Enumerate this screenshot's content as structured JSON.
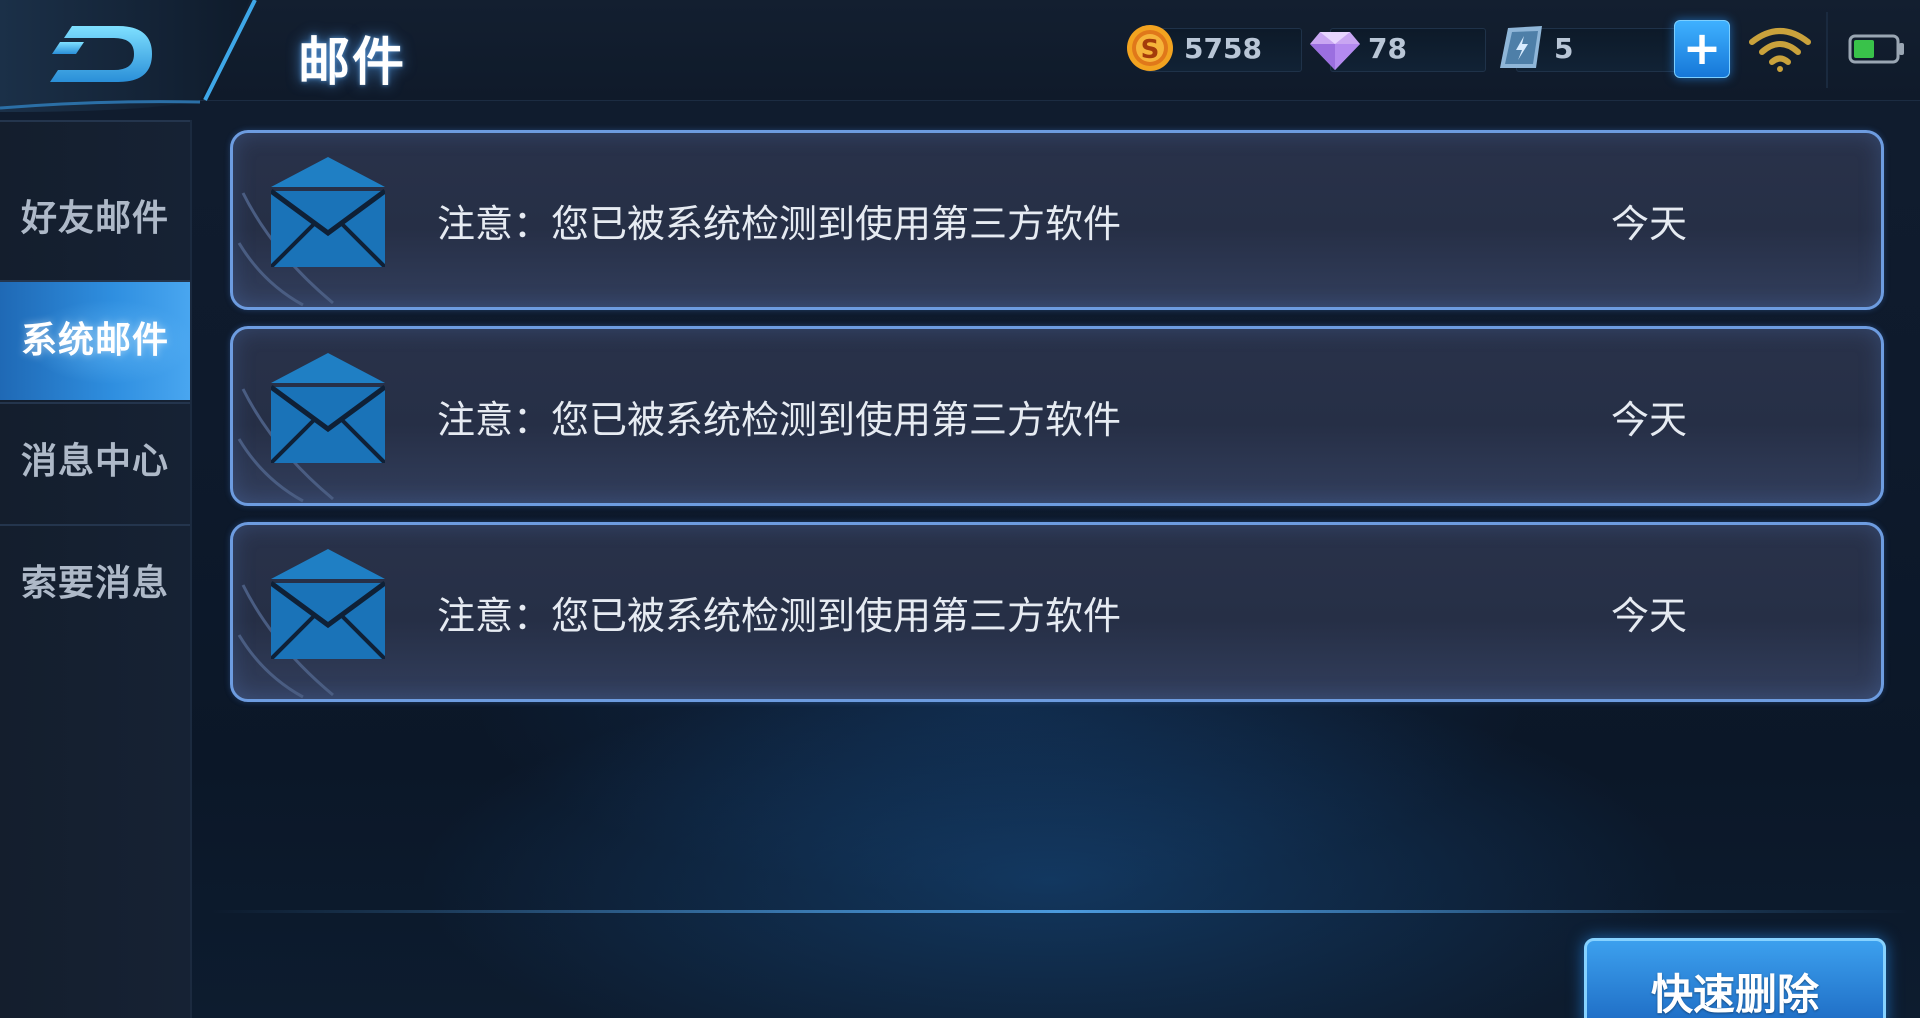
{
  "header": {
    "title": "邮件",
    "back_icon": "back-arrow-icon"
  },
  "resources": {
    "gold": {
      "icon": "gold-coin-icon",
      "value": "5758"
    },
    "diamond": {
      "icon": "diamond-icon",
      "value": "78"
    },
    "voucher": {
      "icon": "voucher-card-icon",
      "value": "5"
    },
    "add_icon": "plus-icon"
  },
  "status": {
    "wifi_icon": "wifi-icon",
    "battery_icon": "battery-icon",
    "battery_level": 0.5
  },
  "sidebar": {
    "items": [
      {
        "label": "好友邮件",
        "active": false
      },
      {
        "label": "系统邮件",
        "active": true
      },
      {
        "label": "消息中心",
        "active": false
      },
      {
        "label": "索要消息",
        "active": false
      }
    ]
  },
  "mails": [
    {
      "subject": "注意：您已被系统检测到使用第三方软件",
      "date": "今天",
      "icon": "envelope-icon"
    },
    {
      "subject": "注意：您已被系统检测到使用第三方软件",
      "date": "今天",
      "icon": "envelope-icon"
    },
    {
      "subject": "注意：您已被系统检测到使用第三方软件",
      "date": "今天",
      "icon": "envelope-icon"
    }
  ],
  "actions": {
    "quick_delete_label": "快速删除"
  },
  "colors": {
    "accent": "#2f8fe0",
    "card_border": "#6d9ce0",
    "background": "#0c1626"
  }
}
